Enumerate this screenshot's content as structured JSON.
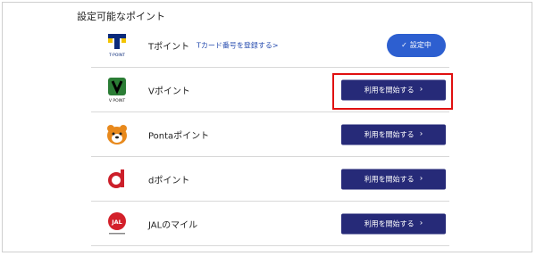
{
  "section": {
    "title": "設定可能なポイント"
  },
  "rows": [
    {
      "name": "Tポイント",
      "link": "Tカード番号を登録する>",
      "action": "設定中",
      "logo": "t-point-logo"
    },
    {
      "name": "Vポイント",
      "action": "利用を開始する",
      "logo": "v-point-logo"
    },
    {
      "name": "Pontaポイント",
      "action": "利用を開始する",
      "logo": "ponta-logo"
    },
    {
      "name": "dポイント",
      "action": "利用を開始する",
      "logo": "d-point-logo"
    },
    {
      "name": "JALのマイル",
      "action": "利用を開始する",
      "logo": "jal-logo"
    }
  ],
  "logos": {
    "t_point_caption": "T-POINT",
    "v_point_caption": "V POINT",
    "jal_text": "JAL"
  },
  "colors": {
    "button": "#262a78",
    "active_pill": "#2d5fd0",
    "highlight": "#e01010"
  }
}
